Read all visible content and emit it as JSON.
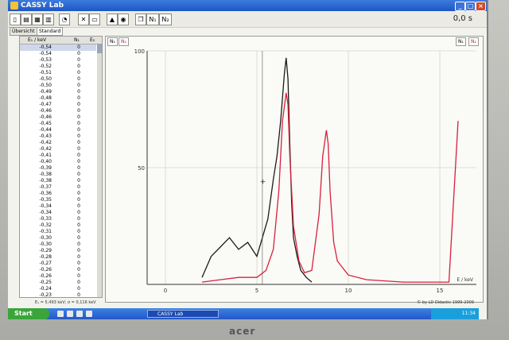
{
  "window": {
    "title": "CASSY Lab",
    "elapsed_time": "0,0 s"
  },
  "titlebar_buttons": {
    "minimize": "_",
    "maximize": "□",
    "close": "×"
  },
  "toolbar": {
    "icons": [
      "new-file-icon",
      "open-file-icon",
      "save-icon",
      "print-icon",
      "clock-icon",
      "window-icon",
      "tools-icon",
      "calculator-icon",
      "warning-icon",
      "gauge-icon",
      "copy-icon"
    ],
    "channel_n1": "N₁",
    "channel_n2": "N₂"
  },
  "tabs": {
    "overview": "Übersicht",
    "standard": "Standard"
  },
  "table": {
    "col_energy": "E₁ / keV",
    "col_n1": "N₁",
    "col_e2": "E₂",
    "rows": [
      {
        "e": "-0,54",
        "n": "0"
      },
      {
        "e": "-0,54",
        "n": "0"
      },
      {
        "e": "-0,53",
        "n": "0"
      },
      {
        "e": "-0,52",
        "n": "0"
      },
      {
        "e": "-0,51",
        "n": "0"
      },
      {
        "e": "-0,50",
        "n": "0"
      },
      {
        "e": "-0,50",
        "n": "0"
      },
      {
        "e": "-0,49",
        "n": "0"
      },
      {
        "e": "-0,48",
        "n": "0"
      },
      {
        "e": "-0,47",
        "n": "0"
      },
      {
        "e": "-0,46",
        "n": "0"
      },
      {
        "e": "-0,46",
        "n": "0"
      },
      {
        "e": "-0,45",
        "n": "0"
      },
      {
        "e": "-0,44",
        "n": "0"
      },
      {
        "e": "-0,43",
        "n": "0"
      },
      {
        "e": "-0,42",
        "n": "0"
      },
      {
        "e": "-0,42",
        "n": "0"
      },
      {
        "e": "-0,41",
        "n": "0"
      },
      {
        "e": "-0,40",
        "n": "0"
      },
      {
        "e": "-0,39",
        "n": "0"
      },
      {
        "e": "-0,38",
        "n": "0"
      },
      {
        "e": "-0,38",
        "n": "0"
      },
      {
        "e": "-0,37",
        "n": "0"
      },
      {
        "e": "-0,36",
        "n": "0"
      },
      {
        "e": "-0,35",
        "n": "0"
      },
      {
        "e": "-0,34",
        "n": "0"
      },
      {
        "e": "-0,34",
        "n": "0"
      },
      {
        "e": "-0,33",
        "n": "0"
      },
      {
        "e": "-0,32",
        "n": "0"
      },
      {
        "e": "-0,31",
        "n": "0"
      },
      {
        "e": "-0,30",
        "n": "0"
      },
      {
        "e": "-0,30",
        "n": "0"
      },
      {
        "e": "-0,29",
        "n": "0"
      },
      {
        "e": "-0,28",
        "n": "0"
      },
      {
        "e": "-0,27",
        "n": "0"
      },
      {
        "e": "-0,26",
        "n": "0"
      },
      {
        "e": "-0,26",
        "n": "0"
      },
      {
        "e": "-0,25",
        "n": "0"
      },
      {
        "e": "-0,24",
        "n": "0"
      },
      {
        "e": "-0,23",
        "n": "0"
      }
    ]
  },
  "plot_controls": {
    "n1": "N₁",
    "n2": "N₂",
    "legend_n1": "N₁",
    "legend_n2": "N₂"
  },
  "chart_data": {
    "type": "line",
    "xlabel": "E / keV",
    "ylabel": "",
    "xlim": [
      -1,
      17
    ],
    "ylim": [
      0,
      100
    ],
    "x_ticks": [
      "0",
      "5",
      "10",
      "15"
    ],
    "y_ticks": [
      "50",
      "100"
    ],
    "grid": true,
    "legend_position": "top-right",
    "series": [
      {
        "name": "N₁",
        "color": "#1a1a1a",
        "x": [
          2.0,
          2.5,
          3.0,
          3.5,
          4.0,
          4.5,
          5.0,
          5.3,
          5.6,
          5.9,
          6.1,
          6.3,
          6.5,
          6.6,
          6.7,
          6.8,
          6.9,
          7.0,
          7.2,
          7.4,
          7.7,
          8.0
        ],
        "y": [
          3,
          12,
          16,
          20,
          15,
          18,
          12,
          20,
          28,
          45,
          55,
          70,
          90,
          97,
          88,
          60,
          35,
          20,
          12,
          6,
          3,
          1
        ]
      },
      {
        "name": "N₂",
        "color": "#d8203a",
        "x": [
          2.0,
          3.0,
          4.0,
          5.0,
          5.5,
          5.9,
          6.2,
          6.4,
          6.6,
          6.7,
          6.8,
          7.0,
          7.3,
          7.6,
          8.0,
          8.4,
          8.6,
          8.8,
          8.9,
          9.0,
          9.2,
          9.4,
          9.6,
          10.0,
          11.0,
          13.0,
          15.5,
          16.0
        ],
        "y": [
          1,
          2,
          3,
          3,
          6,
          15,
          40,
          70,
          82,
          77,
          55,
          25,
          10,
          5,
          6,
          30,
          55,
          66,
          60,
          40,
          18,
          10,
          8,
          4,
          2,
          1,
          1,
          70
        ]
      }
    ],
    "cursor": {
      "x": 5.3,
      "y": 44
    }
  },
  "status": {
    "left": "E₁ = 5,493 keV; σ = 0,116 keV",
    "right": "© by LD Didactic 1999-2009"
  },
  "taskbar": {
    "start": "Start",
    "app": "CASSY Lab",
    "clock": "11:34"
  },
  "monitor": {
    "brand": "acer"
  }
}
